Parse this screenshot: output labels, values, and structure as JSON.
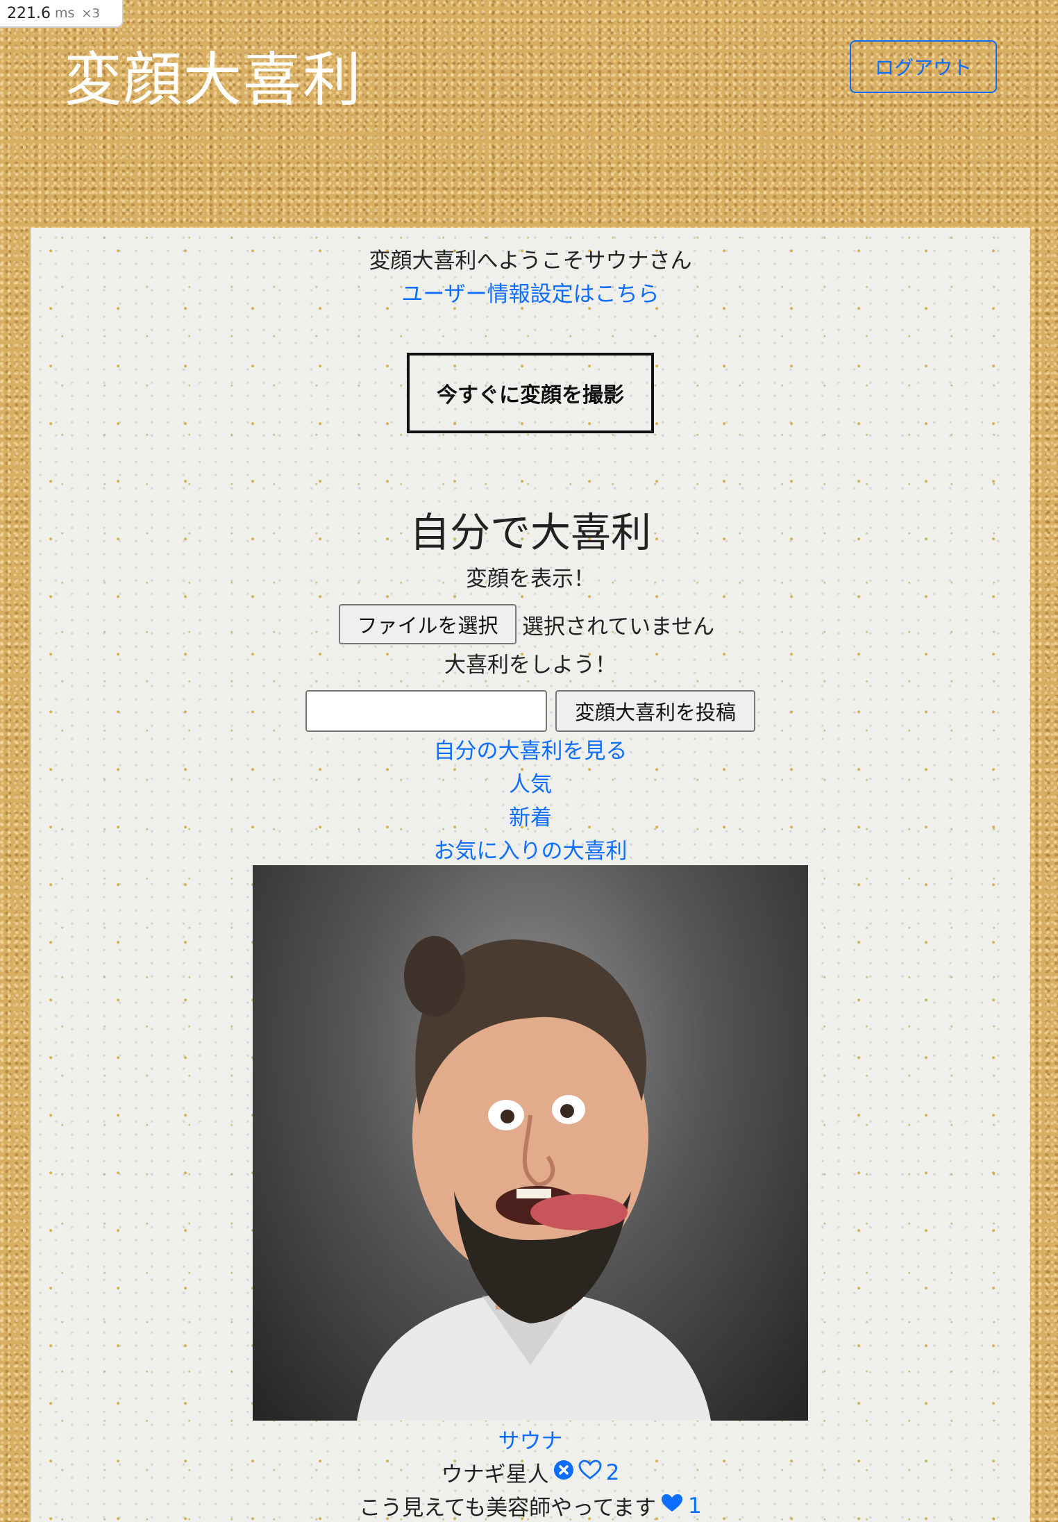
{
  "perf_overlay": {
    "value": "221.6",
    "unit": "ms",
    "multiplier": "×3"
  },
  "header": {
    "title": "変顔大喜利",
    "logout_label": "ログアウト"
  },
  "main": {
    "welcome": "変顔大喜利へようこそサウナさん",
    "settings_link": "ユーザー情報設定はこちら",
    "shoot_button": "今すぐに変顔を撮影",
    "section_title": "自分で大喜利",
    "show_face_label": "変顔を表示！",
    "file_button": "ファイルを選択",
    "file_status": "選択されていません",
    "ogiri_label": "大喜利をしよう！",
    "answer_input": {
      "value": "",
      "placeholder": ""
    },
    "post_button": "変顔大喜利を投稿",
    "nav": {
      "mine": "自分の大喜利を見る",
      "popular": "人気",
      "new": "新着",
      "favorites": "お気に入りの大喜利"
    }
  },
  "post": {
    "poster": "サウナ",
    "answers": [
      {
        "text": "ウナギ星人",
        "likes": "2",
        "liked": false,
        "deletable": true,
        "icons": [
          "delete-icon",
          "heart-outline-icon"
        ]
      },
      {
        "text": "こう見えても美容師やってます",
        "likes": "1",
        "liked": true,
        "deletable": false,
        "icons": [
          "heart-filled-icon"
        ]
      }
    ]
  },
  "colors": {
    "link": "#0d6efd",
    "title": "#ffffff",
    "text": "#222222"
  }
}
